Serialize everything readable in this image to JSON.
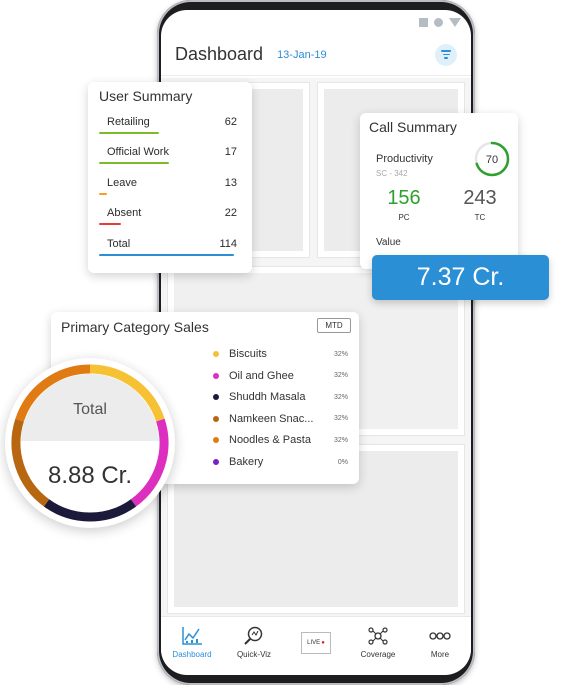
{
  "header": {
    "title": "Dashboard",
    "date": "13-Jan-19"
  },
  "user_summary": {
    "title": "User Summary",
    "rows": [
      {
        "label": "Retailing",
        "value": "62",
        "color": "#7cbc2b"
      },
      {
        "label": "Official Work",
        "value": "17",
        "color": "#7cbc2b"
      },
      {
        "label": "Leave",
        "value": "13",
        "color": "#f5a023"
      },
      {
        "label": "Absent",
        "value": "22",
        "color": "#e63c3c"
      },
      {
        "label": "Total",
        "value": "114",
        "color": "#2b8fd6"
      }
    ]
  },
  "call_summary": {
    "title": "Call Summary",
    "productivity_label": "Productivity",
    "productivity_value": "70",
    "sc_text": "SC - 342",
    "pc_value": "156",
    "pc_label": "PC",
    "tc_value": "243",
    "tc_label": "TC",
    "value_label": "Value",
    "value_amount": "7.37 Cr."
  },
  "category_sales": {
    "title": "Primary Category Sales",
    "period": "MTD",
    "items": [
      {
        "name": "Biscuits",
        "pct": "32%",
        "color": "#f6c233"
      },
      {
        "name": "Oil and Ghee",
        "pct": "32%",
        "color": "#dc2fbf"
      },
      {
        "name": "Shuddh Masala",
        "pct": "32%",
        "color": "#1c1a3a"
      },
      {
        "name": "Namkeen Snac...",
        "pct": "32%",
        "color": "#b8660f"
      },
      {
        "name": "Noodles & Pasta",
        "pct": "32%",
        "color": "#e07a12"
      },
      {
        "name": "Bakery",
        "pct": "0%",
        "color": "#7a1fc9"
      }
    ],
    "total_label": "Total",
    "total_value": "8.88 Cr."
  },
  "nav": [
    {
      "label": "Dashboard",
      "icon": "dashboard-chart-icon",
      "active": true
    },
    {
      "label": "Quick-Viz",
      "icon": "magnifier-icon",
      "active": false
    },
    {
      "label": "",
      "icon": "live-icon",
      "live_text": "LIVE",
      "active": false
    },
    {
      "label": "Coverage",
      "icon": "coverage-network-icon",
      "active": false
    },
    {
      "label": "More",
      "icon": "more-dots-icon",
      "active": false
    }
  ],
  "colors": {
    "accent": "#2b8fd6",
    "green": "#2ea02e"
  }
}
